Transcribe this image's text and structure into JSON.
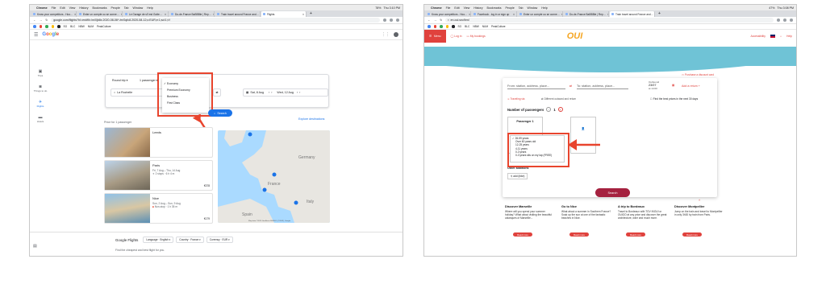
{
  "left": {
    "menubar": {
      "app": "Chrome",
      "menus": [
        "File",
        "Edit",
        "View",
        "History",
        "Bookmarks",
        "People",
        "Tab",
        "Window",
        "Help"
      ],
      "battery": "78%",
      "time": "Thu 3:10 PM"
    },
    "tabs": [
      "Know your competitors - Hoo…",
      "Enter un compte ou se conne…",
      "Le Garage de s'il est Gotte…",
      "Do-de-France BaBBBle | Rep…",
      "Train travel around France and…",
      "Flights"
    ],
    "address": "google.com/flights?hl=en#flt=/m/0jb8x.2020-08-06*./m/0qfc8.2020-08-12;c:EUR;e:1;sd:1;t:f",
    "bookmarks": [
      "SG",
      "BLC",
      "NBW",
      "NUM",
      "PeakCulture"
    ],
    "logo": "Google",
    "side": [
      {
        "icon": "✈",
        "label": "Trips"
      },
      {
        "icon": "⌂",
        "label": "Things to do"
      },
      {
        "icon": "✈",
        "label": "Flights"
      },
      {
        "icon": "▤",
        "label": "Hotels"
      }
    ],
    "search": {
      "trip_type": "Round trip",
      "passengers": "1 passenger",
      "origin": "La Rochelle",
      "depart": "Sat, 8 Aug",
      "return": "Wed, 12 Aug",
      "button": "Search"
    },
    "cabin_options": [
      "Economy",
      "Premium Economy",
      "Business",
      "First Class"
    ],
    "cabin_selected": "Economy",
    "results_title": "Price for 1 passenger",
    "explore_link": "Explore destinations",
    "destinations": [
      {
        "city": "Leeds",
        "dates": "",
        "stops": "",
        "price": ""
      },
      {
        "city": "Paris",
        "dates": "Fri, 7 Aug – Thu, 14 Aug",
        "stops": "2 stops · 6 h 4 m",
        "price": "€378"
      },
      {
        "city": "Nice",
        "dates": "Sun, 2 Aug – Sun, 9 Aug",
        "stops": "Non-stop · 1 h 35 m",
        "price": "€179"
      }
    ],
    "map_labels": [
      "Germany",
      "France",
      "Italy",
      "Spain"
    ],
    "map_credit": "Map data ©2020 GeoBasis-DE/BKG (©2009), Google",
    "footer": {
      "brand": "Google Flights",
      "language": "Language · English",
      "country": "Country · France",
      "currency": "Currency · EUR",
      "tagline": "Find the cheapest and best flight for you."
    }
  },
  "right": {
    "menubar": {
      "app": "Chrome",
      "menus": [
        "File",
        "Edit",
        "View",
        "History",
        "Bookmarks",
        "People",
        "Tab",
        "Window",
        "Help"
      ],
      "battery": "47%",
      "time": "Thu 3:08 PM"
    },
    "tabs": [
      "Know your competitors - Hoo…",
      "Facebook - log in or sign up",
      "Enter un compte ou se conne…",
      "Do-de-France BaBBBle | Rep…",
      "Train travel around France and…"
    ],
    "address": "en.oui.sncf/en/",
    "bookmarks": [
      "SG",
      "BLC",
      "NBW",
      "NUM",
      "PeakCulture"
    ],
    "header": {
      "menu": "Menu",
      "login": "Log in",
      "bookings": "My bookings",
      "logo": "OUI",
      "accessibility": "Accessibility",
      "help": "Help"
    },
    "form": {
      "from": "From: station, address, place...",
      "to": "To: station, address, place...",
      "outbound_label": "Outbound",
      "outbound_date": "23/07",
      "outbound_time": "at 14:00",
      "add_return": "Add a return",
      "discount_link": "Purchase a discount card",
      "best_prices": "Find the best prices in the next 30 days",
      "traveling_via": "Traveling via",
      "different_trip": "Different outward and return",
      "passengers_label": "Number of passengers",
      "passengers_count": "1",
      "passenger_card": "Passenger 1",
      "other_label": "Other additions",
      "add_label": "add (bike)",
      "button": "Search"
    },
    "age_options": [
      "26-59 years",
      "Over 60 years old",
      "12-25 years",
      "4-11 years",
      "0-3 years",
      "0-3 years sits on my lap (FREE)"
    ],
    "age_selected": "26-59 years",
    "promos": [
      {
        "title": "Discover Marseille",
        "text": "Where will you spend your summer holiday? What about visiting the beautiful calanques of Marseille...",
        "button": "Read more"
      },
      {
        "title": "Go to Nice",
        "text": "What about a summer in Southern France? Soak up the sun at one of the fantastic beaches in Nice.",
        "button": "Read more"
      },
      {
        "title": "A trip to Bordeaux",
        "text": "Travel to Bordeaux with TGV INOUI or OUIGO at any price and discover the great architecture, wine and much more.",
        "button": "Read more"
      },
      {
        "title": "Discover Montpellier",
        "text": "Jump on the train and travel to Montpellier in only 3h30 by train from Paris.",
        "button": "Read more"
      }
    ]
  },
  "colors": {
    "annotation": "#e8442d",
    "google_blue": "#1a73e8",
    "oui_red": "#e0423d",
    "oui_burgundy": "#a5213f",
    "wave": "#6fc3d6"
  }
}
